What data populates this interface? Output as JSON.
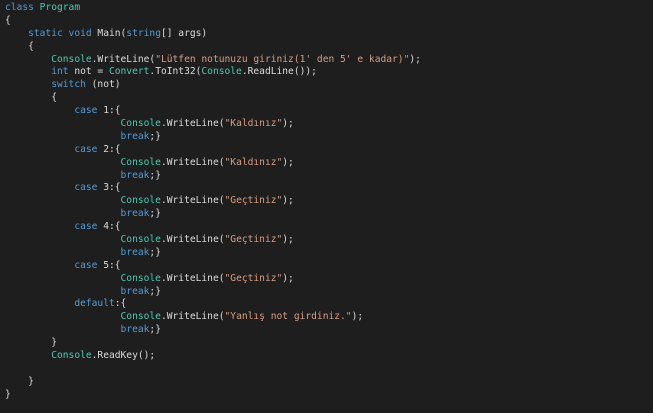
{
  "editor": {
    "language": "C#",
    "colors": {
      "background": "#1e1e1e",
      "keyword": "#569cd6",
      "type": "#4ec9b0",
      "string": "#d69d85",
      "plain": "#dcdcdc"
    },
    "lines": [
      {
        "indent": "",
        "tokens": [
          {
            "t": "kw",
            "v": "class"
          },
          {
            "t": "p",
            "v": " "
          },
          {
            "t": "ty",
            "v": "Program"
          }
        ]
      },
      {
        "indent": "",
        "tokens": [
          {
            "t": "p",
            "v": "{"
          }
        ]
      },
      {
        "indent": "    ",
        "tokens": [
          {
            "t": "kw",
            "v": "static"
          },
          {
            "t": "p",
            "v": " "
          },
          {
            "t": "kw",
            "v": "void"
          },
          {
            "t": "p",
            "v": " Main("
          },
          {
            "t": "kw",
            "v": "string"
          },
          {
            "t": "p",
            "v": "[] args)"
          }
        ]
      },
      {
        "indent": "    ",
        "tokens": [
          {
            "t": "p",
            "v": "{"
          }
        ]
      },
      {
        "indent": "        ",
        "tokens": [
          {
            "t": "ty",
            "v": "Console"
          },
          {
            "t": "p",
            "v": ".WriteLine("
          },
          {
            "t": "st",
            "v": "\"Lütfen notunuzu giriniz(1' den 5' e kadar)\""
          },
          {
            "t": "p",
            "v": ");"
          }
        ]
      },
      {
        "indent": "        ",
        "tokens": [
          {
            "t": "kw",
            "v": "int"
          },
          {
            "t": "p",
            "v": " not = "
          },
          {
            "t": "ty",
            "v": "Convert"
          },
          {
            "t": "p",
            "v": ".ToInt32("
          },
          {
            "t": "ty",
            "v": "Console"
          },
          {
            "t": "p",
            "v": ".ReadLine());"
          }
        ]
      },
      {
        "indent": "        ",
        "tokens": [
          {
            "t": "kw",
            "v": "switch"
          },
          {
            "t": "p",
            "v": " (not)"
          }
        ]
      },
      {
        "indent": "        ",
        "tokens": [
          {
            "t": "p",
            "v": "{"
          }
        ]
      },
      {
        "indent": "            ",
        "tokens": [
          {
            "t": "kw",
            "v": "case"
          },
          {
            "t": "p",
            "v": " 1:{"
          }
        ]
      },
      {
        "indent": "                    ",
        "tokens": [
          {
            "t": "ty",
            "v": "Console"
          },
          {
            "t": "p",
            "v": ".WriteLine("
          },
          {
            "t": "st",
            "v": "\"Kaldınız\""
          },
          {
            "t": "p",
            "v": ");"
          }
        ]
      },
      {
        "indent": "                    ",
        "tokens": [
          {
            "t": "kw",
            "v": "break"
          },
          {
            "t": "p",
            "v": ";}"
          }
        ]
      },
      {
        "indent": "            ",
        "tokens": [
          {
            "t": "kw",
            "v": "case"
          },
          {
            "t": "p",
            "v": " 2:{"
          }
        ]
      },
      {
        "indent": "                    ",
        "tokens": [
          {
            "t": "ty",
            "v": "Console"
          },
          {
            "t": "p",
            "v": ".WriteLine("
          },
          {
            "t": "st",
            "v": "\"Kaldınız\""
          },
          {
            "t": "p",
            "v": ");"
          }
        ]
      },
      {
        "indent": "                    ",
        "tokens": [
          {
            "t": "kw",
            "v": "break"
          },
          {
            "t": "p",
            "v": ";}"
          }
        ]
      },
      {
        "indent": "            ",
        "tokens": [
          {
            "t": "kw",
            "v": "case"
          },
          {
            "t": "p",
            "v": " 3:{"
          }
        ]
      },
      {
        "indent": "                    ",
        "tokens": [
          {
            "t": "ty",
            "v": "Console"
          },
          {
            "t": "p",
            "v": ".WriteLine("
          },
          {
            "t": "st",
            "v": "\"Geçtiniz\""
          },
          {
            "t": "p",
            "v": ");"
          }
        ]
      },
      {
        "indent": "                    ",
        "tokens": [
          {
            "t": "kw",
            "v": "break"
          },
          {
            "t": "p",
            "v": ";}"
          }
        ]
      },
      {
        "indent": "            ",
        "tokens": [
          {
            "t": "kw",
            "v": "case"
          },
          {
            "t": "p",
            "v": " 4:{"
          }
        ]
      },
      {
        "indent": "                    ",
        "tokens": [
          {
            "t": "ty",
            "v": "Console"
          },
          {
            "t": "p",
            "v": ".WriteLine("
          },
          {
            "t": "st",
            "v": "\"Geçtiniz\""
          },
          {
            "t": "p",
            "v": ");"
          }
        ]
      },
      {
        "indent": "                    ",
        "tokens": [
          {
            "t": "kw",
            "v": "break"
          },
          {
            "t": "p",
            "v": ";}"
          }
        ]
      },
      {
        "indent": "            ",
        "tokens": [
          {
            "t": "kw",
            "v": "case"
          },
          {
            "t": "p",
            "v": " 5:{"
          }
        ]
      },
      {
        "indent": "                    ",
        "tokens": [
          {
            "t": "ty",
            "v": "Console"
          },
          {
            "t": "p",
            "v": ".WriteLine("
          },
          {
            "t": "st",
            "v": "\"Geçtiniz\""
          },
          {
            "t": "p",
            "v": ");"
          }
        ]
      },
      {
        "indent": "                    ",
        "tokens": [
          {
            "t": "kw",
            "v": "break"
          },
          {
            "t": "p",
            "v": ";}"
          }
        ]
      },
      {
        "indent": "            ",
        "tokens": [
          {
            "t": "kw",
            "v": "default"
          },
          {
            "t": "p",
            "v": ":{"
          }
        ]
      },
      {
        "indent": "                    ",
        "tokens": [
          {
            "t": "ty",
            "v": "Console"
          },
          {
            "t": "p",
            "v": ".WriteLine("
          },
          {
            "t": "st",
            "v": "\"Yanlış not girdiniz.\""
          },
          {
            "t": "p",
            "v": ");"
          }
        ]
      },
      {
        "indent": "                    ",
        "tokens": [
          {
            "t": "kw",
            "v": "break"
          },
          {
            "t": "p",
            "v": ";}"
          }
        ]
      },
      {
        "indent": "        ",
        "tokens": [
          {
            "t": "p",
            "v": "}"
          }
        ]
      },
      {
        "indent": "        ",
        "tokens": [
          {
            "t": "ty",
            "v": "Console"
          },
          {
            "t": "p",
            "v": ".ReadKey();"
          }
        ]
      },
      {
        "indent": "",
        "tokens": [
          {
            "t": "p",
            "v": ""
          }
        ]
      },
      {
        "indent": "    ",
        "tokens": [
          {
            "t": "p",
            "v": "}"
          }
        ]
      },
      {
        "indent": "",
        "tokens": [
          {
            "t": "p",
            "v": "}"
          }
        ]
      }
    ]
  }
}
